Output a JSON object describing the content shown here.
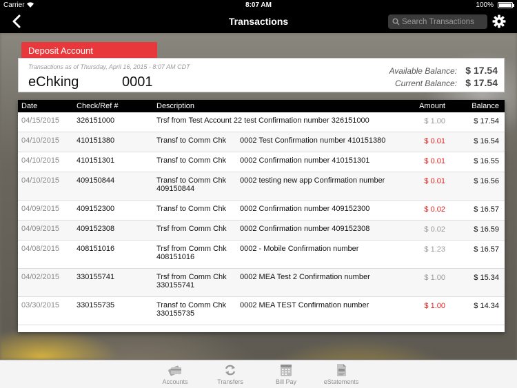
{
  "status_bar": {
    "carrier": "Carrier",
    "time": "8:07 AM",
    "battery": "100%"
  },
  "nav": {
    "title": "Transactions",
    "search_placeholder": "Search Transactions",
    "back_icon": "chevron-left-icon",
    "settings_icon": "gear-icon"
  },
  "account": {
    "tab_label": "Deposit Account",
    "as_of": "Transactions as of Thursday, April 16, 2015 - 8:07 AM CDT",
    "name": "eChking",
    "number": "0001",
    "available_label": "Available Balance:",
    "available_value": "$ 17.54",
    "current_label": "Current Balance:",
    "current_value": "$ 17.54"
  },
  "table": {
    "headers": {
      "date": "Date",
      "ref": "Check/Ref #",
      "description": "Description",
      "amount": "Amount",
      "balance": "Balance"
    },
    "rows": [
      {
        "date": "04/15/2015",
        "ref": "326151000",
        "desc1": "Trsf from Test Account 22 test Confirmation number  326151000",
        "desc1b": "",
        "desc2": "",
        "amount": "$ 1.00",
        "negative": false,
        "balance": "$ 17.54"
      },
      {
        "date": "04/10/2015",
        "ref": "410151380",
        "desc1": "Transf to Comm Chk",
        "desc1b": "",
        "desc2": "0002 Test Confirmation number  410151380",
        "amount": "$ 0.01",
        "negative": true,
        "balance": "$ 16.54"
      },
      {
        "date": "04/10/2015",
        "ref": "410151301",
        "desc1": "Transf to Comm Chk",
        "desc1b": "",
        "desc2": "0002 Confirmation number  410151301",
        "amount": "$ 0.01",
        "negative": true,
        "balance": "$ 16.55"
      },
      {
        "date": "04/10/2015",
        "ref": "409150844",
        "desc1": "Transf to Comm Chk",
        "desc1b": "409150844",
        "desc2": "0002 testing new app Confirmation number",
        "amount": "$ 0.01",
        "negative": true,
        "balance": "$ 16.56"
      },
      {
        "date": "04/09/2015",
        "ref": "409152300",
        "desc1": "Transf to Comm Chk",
        "desc1b": "",
        "desc2": "0002 Confirmation number  409152300",
        "amount": "$ 0.02",
        "negative": true,
        "balance": "$ 16.57"
      },
      {
        "date": "04/09/2015",
        "ref": "409152308",
        "desc1": "Trsf from Comm Chk",
        "desc1b": "",
        "desc2": "0002 Confirmation number  409152308",
        "amount": "$ 0.02",
        "negative": false,
        "balance": "$ 16.59"
      },
      {
        "date": "04/08/2015",
        "ref": "408151016",
        "desc1": "Trsf from Comm Chk",
        "desc1b": "408151016",
        "desc2": "0002 - Mobile Confirmation number",
        "amount": "$ 1.23",
        "negative": false,
        "balance": "$ 16.57"
      },
      {
        "date": "04/02/2015",
        "ref": "330155741",
        "desc1": "Trsf from Comm Chk",
        "desc1b": "330155741",
        "desc2": "0002 MEA Test 2 Confirmation number",
        "amount": "$ 1.00",
        "negative": false,
        "balance": "$ 15.34"
      },
      {
        "date": "03/30/2015",
        "ref": "330155735",
        "desc1": "Transf to Comm Chk",
        "desc1b": "330155735",
        "desc2": "0002 MEA TEST Confirmation number",
        "amount": "$ 1.00",
        "negative": true,
        "balance": "$ 14.34"
      }
    ]
  },
  "tabbar": {
    "items": [
      {
        "label": "Accounts",
        "icon": "accounts-card-icon"
      },
      {
        "label": "Transfers",
        "icon": "transfer-arrows-icon"
      },
      {
        "label": "Bill Pay",
        "icon": "calendar-icon"
      },
      {
        "label": "eStatements",
        "icon": "pdf-document-icon"
      }
    ]
  },
  "colors": {
    "accent_red": "#e8383b",
    "debit_red": "#e21d1d",
    "bar_black": "#000000"
  }
}
